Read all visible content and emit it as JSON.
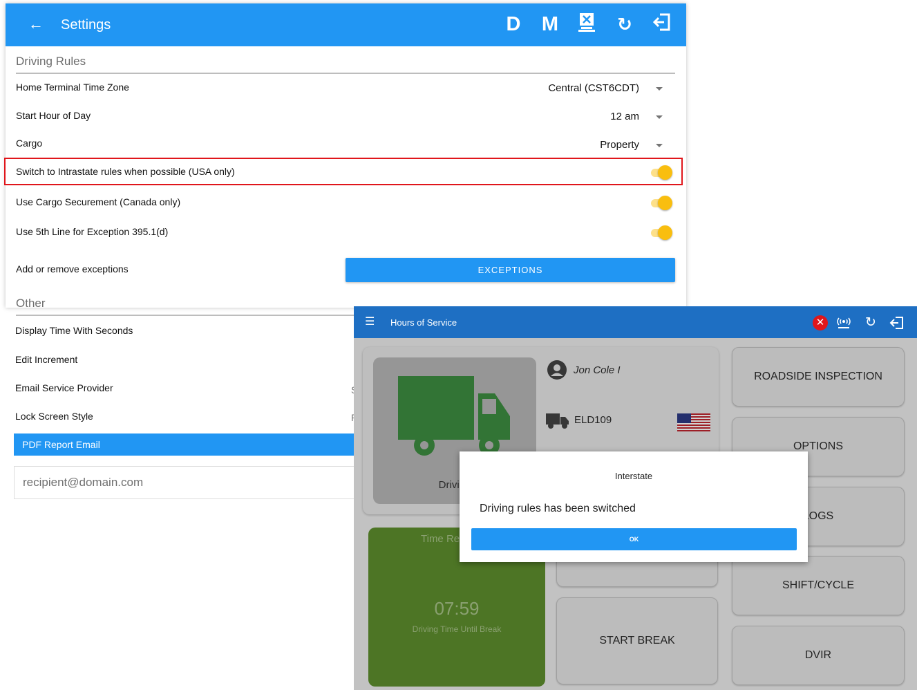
{
  "settings": {
    "title": "Settings",
    "actions": {
      "d": "D",
      "m": "M"
    },
    "driving_rules": {
      "heading": "Driving Rules",
      "home_tz_label": "Home Terminal Time Zone",
      "home_tz_value": "Central (CST6CDT)",
      "start_hour_label": "Start Hour of Day",
      "start_hour_value": "12 am",
      "cargo_label": "Cargo",
      "cargo_value": "Property",
      "intrastate_label": "Switch to Intrastate rules when possible (USA only)",
      "cargo_securement_label": "Use Cargo Securement (Canada only)",
      "fifth_line_label": "Use 5th Line for Exception 395.1(d)",
      "exceptions_label": "Add or remove exceptions",
      "exceptions_button": "EXCEPTIONS"
    },
    "other": {
      "heading": "Other",
      "display_seconds_label": "Display Time With Seconds",
      "edit_increment_label": "Edit Increment",
      "email_provider_label": "Email Service Provider",
      "lock_screen_label": "Lock Screen Style",
      "pdf_email_label": "PDF Report Email",
      "pdf_email_placeholder": "recipient@domain.com"
    },
    "toggles": {
      "intrastate": true,
      "cargo_securement": true,
      "fifth_line": true
    },
    "colors": {
      "primary": "#2196f3",
      "toggle_on": "#f9be0f",
      "highlight": "#e0161b"
    }
  },
  "hos": {
    "title": "Hours of Service",
    "driver_name": "Jon Cole I",
    "vehicle": "ELD109",
    "status": "Driving",
    "time_caption": "Time Re",
    "time_value": "07:59",
    "time_sub": "Driving Time Until Break",
    "buttons": {
      "roadside": "ROADSIDE INSPECTION",
      "options": "OPTIONS",
      "logs": "LOGS",
      "shift_cycle": "SHIFT/CYCLE",
      "start_break": "START BREAK",
      "dvir": "DVIR"
    },
    "colors": {
      "app_bar": "#1e6fc3",
      "time_card": "#5e8f2e",
      "status_tile": "#b7b7b7"
    }
  },
  "dialog": {
    "title": "Interstate",
    "message": "Driving rules has been switched",
    "ok": "OK"
  }
}
